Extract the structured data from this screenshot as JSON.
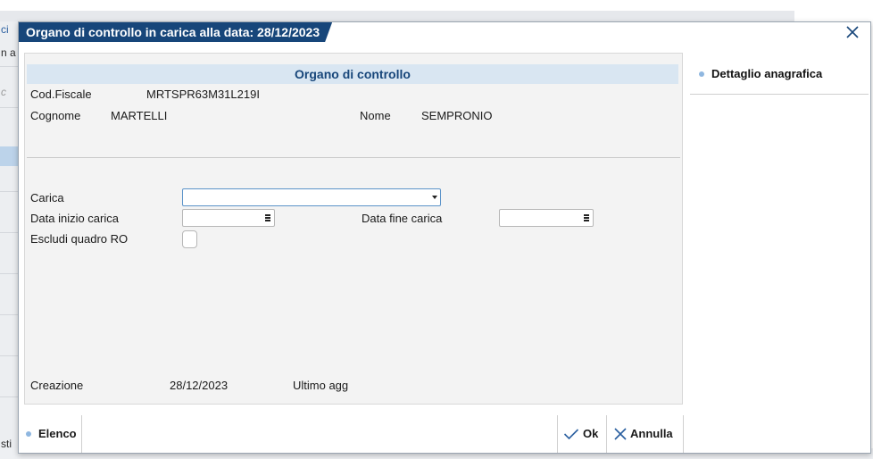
{
  "background": {
    "left_fragments": [
      "ci",
      "n a",
      "c",
      "sti"
    ]
  },
  "dialog": {
    "title": "Organo di controllo in carica alla data: 28/12/2023",
    "close_icon": "close-icon"
  },
  "section": {
    "title": "Organo di controllo"
  },
  "person": {
    "cod_fiscale_label": "Cod.Fiscale",
    "cod_fiscale_value": "MRTSPR63M31L219I",
    "cognome_label": "Cognome",
    "cognome_value": "MARTELLI",
    "nome_label": "Nome",
    "nome_value": "SEMPRONIO"
  },
  "form": {
    "carica_label": "Carica",
    "carica_value": "",
    "data_inizio_label": "Data inizio carica",
    "data_inizio_value": "",
    "data_fine_label": "Data fine carica",
    "data_fine_value": "",
    "escludi_label": "Escludi quadro RO",
    "escludi_checked": false
  },
  "footer_info": {
    "creazione_label": "Creazione",
    "creazione_value": "28/12/2023",
    "ultimo_agg_label": "Ultimo agg",
    "ultimo_agg_value": ""
  },
  "side": {
    "items": [
      {
        "label": "Dettaglio anagrafica"
      }
    ]
  },
  "bottom": {
    "elenco_label": "Elenco",
    "ok_label": "Ok",
    "annulla_label": "Annulla"
  },
  "colors": {
    "title_bg": "#17467a",
    "section_bg": "#d9e6f2",
    "accent_dot": "#8fb7e0"
  }
}
